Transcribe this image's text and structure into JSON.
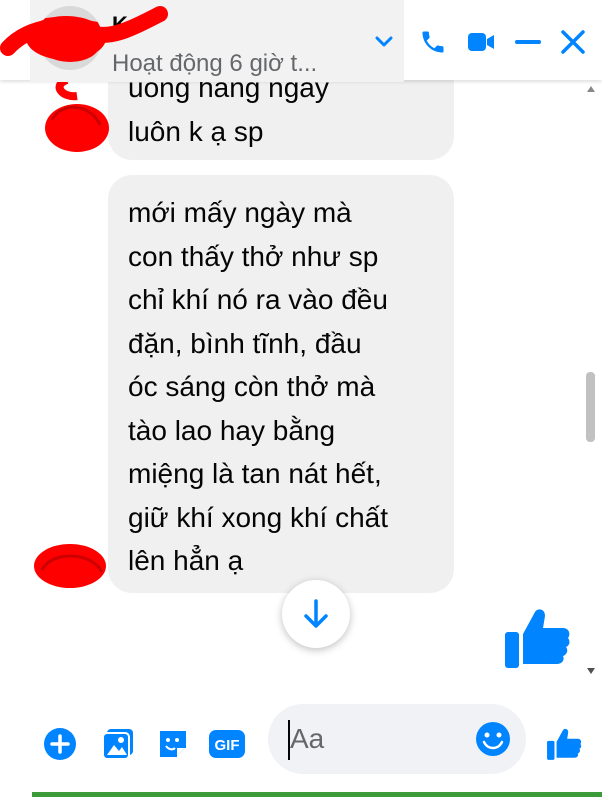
{
  "header": {
    "contact_name": "Ka",
    "contact_status": "Hoạt động 6 giờ t...",
    "icons": {
      "dropdown": "chevron-down-icon",
      "call": "phone-icon",
      "video": "video-camera-icon",
      "minimize": "minimize-icon",
      "close": "close-icon"
    },
    "accent_color": "#0084ff"
  },
  "messages": [
    {
      "lines": [
        "uống hàng ngày",
        "luôn k ạ sp"
      ]
    },
    {
      "lines": [
        "mới mấy ngày mà",
        "con thấy thở như sp",
        "chỉ khí nó ra vào đều",
        "đặn, bình tĩnh, đầu",
        "óc sáng còn thở mà",
        "tào lao hay bằng",
        "miệng là tan nát hết,",
        "giữ khí xong khí chất",
        "lên hẳn ạ"
      ]
    }
  ],
  "chat": {
    "scroll_down_icon": "arrow-down-icon",
    "sent_like_icon": "thumbs-up-icon"
  },
  "composer": {
    "placeholder": "Aa",
    "icons": [
      "plus-circle-icon",
      "image-icon",
      "sticker-icon",
      "gif-icon",
      "emoji-icon",
      "thumbs-up-icon"
    ],
    "gif_label": "GIF"
  }
}
